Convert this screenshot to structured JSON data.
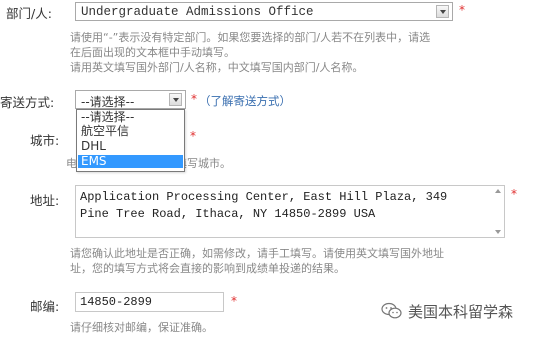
{
  "department": {
    "label": "部门/人:",
    "value": "Undergraduate Admissions Office",
    "required_mark": "*",
    "hint_lines": [
      "请使用“-”表示没有特定部门。如果您要选择的部门/人若不在列表中，请选",
      "在后面出现的文本框中手动填写。",
      "请用英文填写国外部门/人名称，中文填写国内部门/人名称。"
    ]
  },
  "shipping": {
    "label": "寄送方式:",
    "value": "--请选择--",
    "help_star": "*",
    "help_link": "（了解寄送方式）",
    "options": [
      "--请选择--",
      "航空平信",
      "DHL",
      "EMS"
    ],
    "highlighted_option": "EMS"
  },
  "city": {
    "label": "城市:",
    "required_mark": "*",
    "hint": "电子版成绩单请现在选填写城市。"
  },
  "address": {
    "label": "地址:",
    "required_mark": "*",
    "value_lines": [
      "Application Processing Center, East Hill Plaza, 349",
      "Pine Tree Road, Ithaca, NY 14850-2899 USA"
    ],
    "hint_lines": [
      "请您确认此地址是否正确，如需修改，请手工填写。请使用英文填写国外地址",
      "址，您的填写方式将会直接的影响到成绩单投递的结果。"
    ]
  },
  "postcode": {
    "label": "邮编:",
    "value": "14850-2899",
    "required_mark": "*",
    "hint": "请仔细核对邮编，保证准确。"
  },
  "watermark": {
    "icon": "wechat-logo-icon",
    "text": "美国本科留学森"
  },
  "colors": {
    "required": "#e03030",
    "link": "#3a6fb0",
    "hint": "#888888",
    "selection": "#3399ff"
  }
}
